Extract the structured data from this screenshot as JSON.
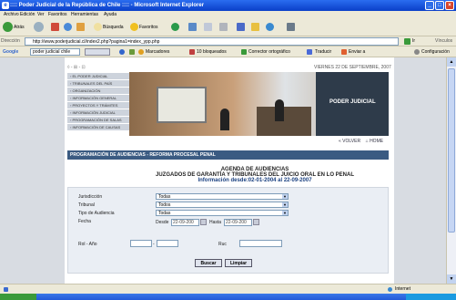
{
  "window": {
    "title": ":::: Poder Judicial de la República de Chile :::: - Microsoft Internet Explorer",
    "controls": [
      "_",
      "□",
      "×"
    ]
  },
  "menu": [
    "Archivo",
    "Edición",
    "Ver",
    "Favoritos",
    "Herramientas",
    "Ayuda"
  ],
  "toolbar": {
    "back": "Atrás",
    "search": "Búsqueda",
    "favorites": "Favoritos"
  },
  "address": {
    "label": "Dirección",
    "url": "http://www.poderjudicial.cl/index2.php?pagina1=index_ypp.php",
    "go": "Ir",
    "links": "Vínculos"
  },
  "google_bar": {
    "label": "Google",
    "query": "poder judicial chile",
    "bookmarks": "Marcadores",
    "blocked": "10 bloqueados",
    "spell": "Corrector ortográfico",
    "translate": "Traducir",
    "send": "Enviar a",
    "settings": "Configuración"
  },
  "page": {
    "breadcrumb": "◊ - ⊞ - ⊡",
    "date": "VIERNES 22 DE SEPTIEMBRE, 2007",
    "nav": [
      "EL PODER JUDICIAL",
      "TRIBUNALES DEL PAÍS",
      "ORGANIZACIÓN",
      "INFORMACIÓN GENERAL",
      "PROYECTOS Y TRÁMITES",
      "INFORMACIÓN JUDICIAL",
      "PROGRAMACIÓN DE SALAS",
      "INFORMACIÓN DE CAUSAS"
    ],
    "photo_logo": "PODER JUDICIAL",
    "link_back": "« VOLVER",
    "link_home": "⌂ HOME",
    "section_title": "PROGRAMACIÓN DE AUDIENCIAS - REFORMA PROCESAL PENAL",
    "agenda": {
      "line1": "AGENDA DE AUDIENCIAS",
      "line2": "JUZGADOS DE GARANTÍA Y TRIBUNALES DEL JUICIO ORAL EN LO PENAL",
      "line3": "Información desde:02-01-2004 al 22-09-2007"
    },
    "form": {
      "jurisdiccion_label": "Jurisdicción",
      "jurisdiccion_value": "Todas",
      "tribunal_label": "Tribunal",
      "tribunal_value": "Todos",
      "tipo_label": "Tipo de Audiencia",
      "tipo_value": "Todas",
      "fecha_label": "Fecha",
      "desde_label": "Desde",
      "desde_value": "22-09-200",
      "hasta_label": "Hasta",
      "hasta_value": "22-09-200",
      "rol_label": "Rol - Año",
      "ruc_label": "Ruc",
      "buscar": "Buscar",
      "limpiar": "Limpiar"
    }
  },
  "status": {
    "zone": "Internet"
  }
}
